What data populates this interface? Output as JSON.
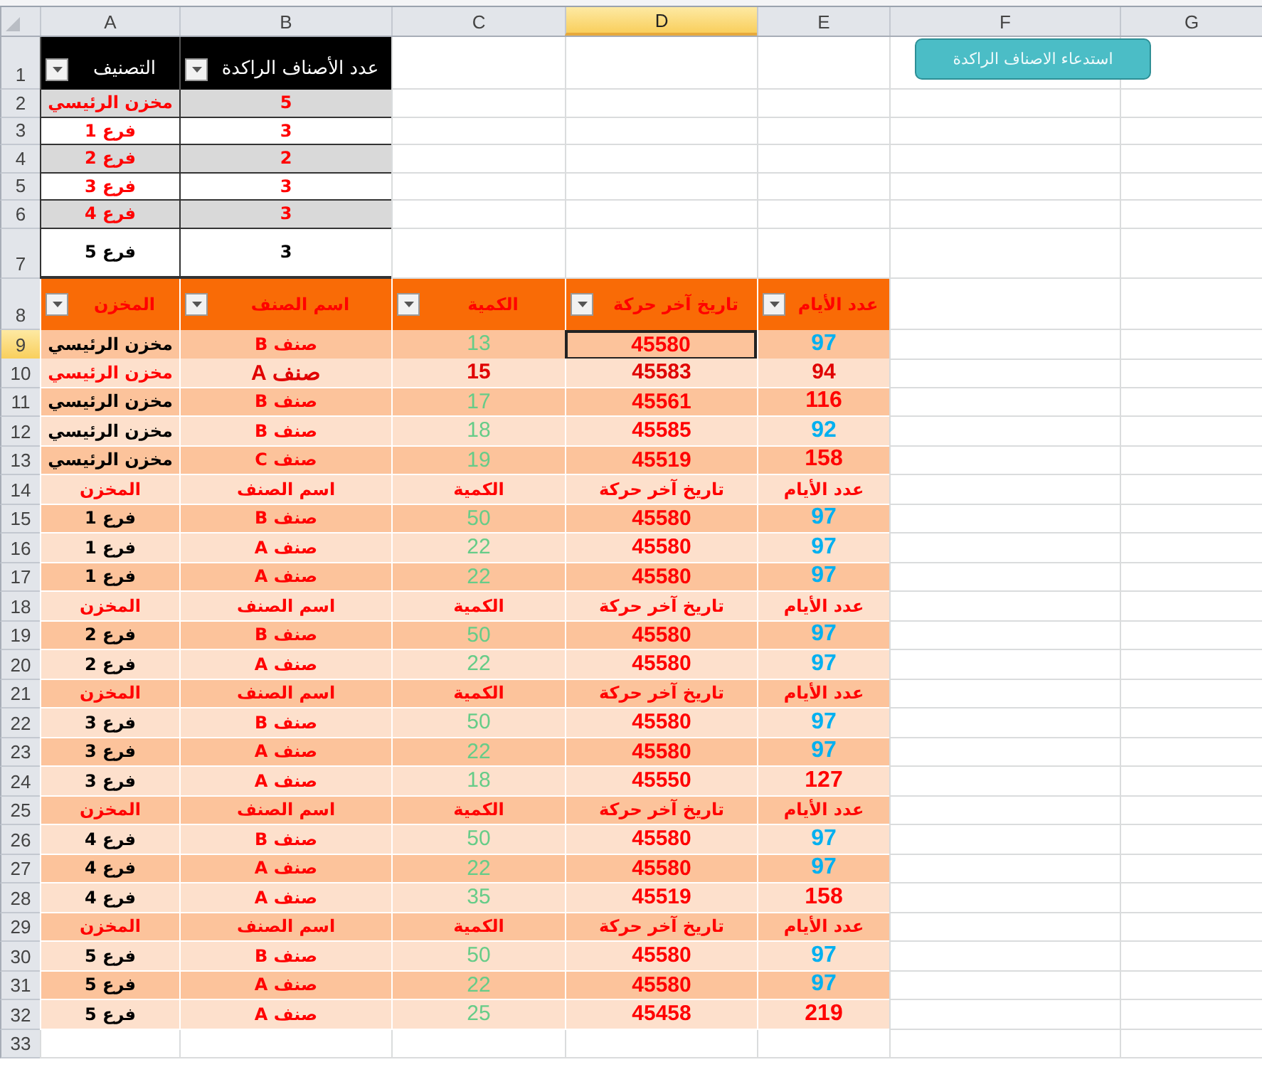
{
  "column_headers": [
    {
      "label": "G",
      "selected": false
    },
    {
      "label": "F",
      "selected": false
    },
    {
      "label": "E",
      "selected": false
    },
    {
      "label": "D",
      "selected": true
    },
    {
      "label": "C",
      "selected": false
    },
    {
      "label": "B",
      "selected": false
    },
    {
      "label": "A",
      "selected": false
    }
  ],
  "macro_button": {
    "label": "استدعاء الاصناف الراكدة"
  },
  "summary_table": {
    "row_number": "1",
    "columns": [
      "عدد الأصناف الراكدة",
      "التصنيف"
    ],
    "rows": [
      {
        "row_number": "2",
        "highlight": true,
        "cells": [
          "5",
          "مخزن الرئيسي"
        ]
      },
      {
        "row_number": "3",
        "highlight": true,
        "cells": [
          "3",
          "فرع 1"
        ]
      },
      {
        "row_number": "4",
        "highlight": true,
        "cells": [
          "2",
          "فرع 2"
        ]
      },
      {
        "row_number": "5",
        "highlight": true,
        "cells": [
          "3",
          "فرع 3"
        ]
      },
      {
        "row_number": "6",
        "highlight": true,
        "cells": [
          "3",
          "فرع 4"
        ]
      },
      {
        "row_number": "7",
        "highlight": false,
        "cells": [
          "3",
          "فرع 5"
        ]
      }
    ]
  },
  "stock_table": {
    "row_number": "8",
    "columns": [
      "عدد الأيام",
      "تاريخ آخر حركة",
      "الكمية",
      "اسم الصنف",
      "المخزن"
    ],
    "rows": [
      {
        "row_number": "9",
        "kind": "data",
        "selected": true,
        "highlight": false,
        "color": "#00b0f0",
        "cells": [
          "97",
          "45580",
          "13",
          "صنف B",
          "مخزن الرئيسي"
        ]
      },
      {
        "row_number": "10",
        "kind": "data",
        "selected": false,
        "highlight": true,
        "color": "#e00000",
        "cells": [
          "94",
          "45583",
          "15",
          "صنف A",
          "مخزن الرئيسي"
        ]
      },
      {
        "row_number": "11",
        "kind": "data",
        "selected": false,
        "highlight": false,
        "color": "#ff0000",
        "cells": [
          "116",
          "45561",
          "17",
          "صنف B",
          "مخزن الرئيسي"
        ]
      },
      {
        "row_number": "12",
        "kind": "data",
        "selected": false,
        "highlight": false,
        "color": "#00b0f0",
        "cells": [
          "92",
          "45585",
          "18",
          "صنف B",
          "مخزن الرئيسي"
        ]
      },
      {
        "row_number": "13",
        "kind": "data",
        "selected": false,
        "highlight": false,
        "color": "#ff0000",
        "cells": [
          "158",
          "45519",
          "19",
          "صنف  C",
          "مخزن الرئيسي"
        ]
      },
      {
        "row_number": "14",
        "kind": "header",
        "selected": false,
        "cells": [
          "عدد الأيام",
          "تاريخ آخر حركة",
          "الكمية",
          "اسم الصنف",
          "المخزن"
        ]
      },
      {
        "row_number": "15",
        "kind": "data",
        "selected": false,
        "highlight": false,
        "color": "#00b0f0",
        "cells": [
          "97",
          "45580",
          "50",
          "صنف B",
          "فرع 1"
        ]
      },
      {
        "row_number": "16",
        "kind": "data",
        "selected": false,
        "highlight": false,
        "color": "#00b0f0",
        "cells": [
          "97",
          "45580",
          "22",
          "صنف A",
          "فرع 1"
        ]
      },
      {
        "row_number": "17",
        "kind": "data",
        "selected": false,
        "highlight": false,
        "color": "#00b0f0",
        "cells": [
          "97",
          "45580",
          "22",
          "صنف A",
          "فرع 1"
        ]
      },
      {
        "row_number": "18",
        "kind": "header",
        "selected": false,
        "cells": [
          "عدد الأيام",
          "تاريخ آخر حركة",
          "الكمية",
          "اسم الصنف",
          "المخزن"
        ]
      },
      {
        "row_number": "19",
        "kind": "data",
        "selected": false,
        "highlight": false,
        "color": "#00b0f0",
        "cells": [
          "97",
          "45580",
          "50",
          "صنف B",
          "فرع 2"
        ]
      },
      {
        "row_number": "20",
        "kind": "data",
        "selected": false,
        "highlight": false,
        "color": "#00b0f0",
        "cells": [
          "97",
          "45580",
          "22",
          "صنف A",
          "فرع 2"
        ]
      },
      {
        "row_number": "21",
        "kind": "header",
        "selected": false,
        "cells": [
          "عدد الأيام",
          "تاريخ آخر حركة",
          "الكمية",
          "اسم الصنف",
          "المخزن"
        ]
      },
      {
        "row_number": "22",
        "kind": "data",
        "selected": false,
        "highlight": false,
        "color": "#00b0f0",
        "cells": [
          "97",
          "45580",
          "50",
          "صنف B",
          "فرع 3"
        ]
      },
      {
        "row_number": "23",
        "kind": "data",
        "selected": false,
        "highlight": false,
        "color": "#00b0f0",
        "cells": [
          "97",
          "45580",
          "22",
          "صنف A",
          "فرع 3"
        ]
      },
      {
        "row_number": "24",
        "kind": "data",
        "selected": false,
        "highlight": false,
        "color": "#ff0000",
        "cells": [
          "127",
          "45550",
          "18",
          "صنف A",
          "فرع 3"
        ]
      },
      {
        "row_number": "25",
        "kind": "header",
        "selected": false,
        "cells": [
          "عدد الأيام",
          "تاريخ آخر حركة",
          "الكمية",
          "اسم الصنف",
          "المخزن"
        ]
      },
      {
        "row_number": "26",
        "kind": "data",
        "selected": false,
        "highlight": false,
        "color": "#00b0f0",
        "cells": [
          "97",
          "45580",
          "50",
          "صنف B",
          "فرع 4"
        ]
      },
      {
        "row_number": "27",
        "kind": "data",
        "selected": false,
        "highlight": false,
        "color": "#00b0f0",
        "cells": [
          "97",
          "45580",
          "22",
          "صنف A",
          "فرع 4"
        ]
      },
      {
        "row_number": "28",
        "kind": "data",
        "selected": false,
        "highlight": false,
        "color": "#ff0000",
        "cells": [
          "158",
          "45519",
          "35",
          "صنف A",
          "فرع 4"
        ]
      },
      {
        "row_number": "29",
        "kind": "header",
        "selected": false,
        "cells": [
          "عدد الأيام",
          "تاريخ آخر حركة",
          "الكمية",
          "اسم الصنف",
          "المخزن"
        ]
      },
      {
        "row_number": "30",
        "kind": "data",
        "selected": false,
        "highlight": false,
        "color": "#00b0f0",
        "cells": [
          "97",
          "45580",
          "50",
          "صنف B",
          "فرع 5"
        ]
      },
      {
        "row_number": "31",
        "kind": "data",
        "selected": false,
        "highlight": false,
        "color": "#00b0f0",
        "cells": [
          "97",
          "45580",
          "22",
          "صنف A",
          "فرع 5"
        ]
      },
      {
        "row_number": "32",
        "kind": "data",
        "selected": false,
        "highlight": false,
        "color": "#ff0000",
        "cells": [
          "219",
          "45458",
          "25",
          "صنف A",
          "فرع 5"
        ]
      }
    ]
  },
  "empty_rows": [
    "33"
  ]
}
